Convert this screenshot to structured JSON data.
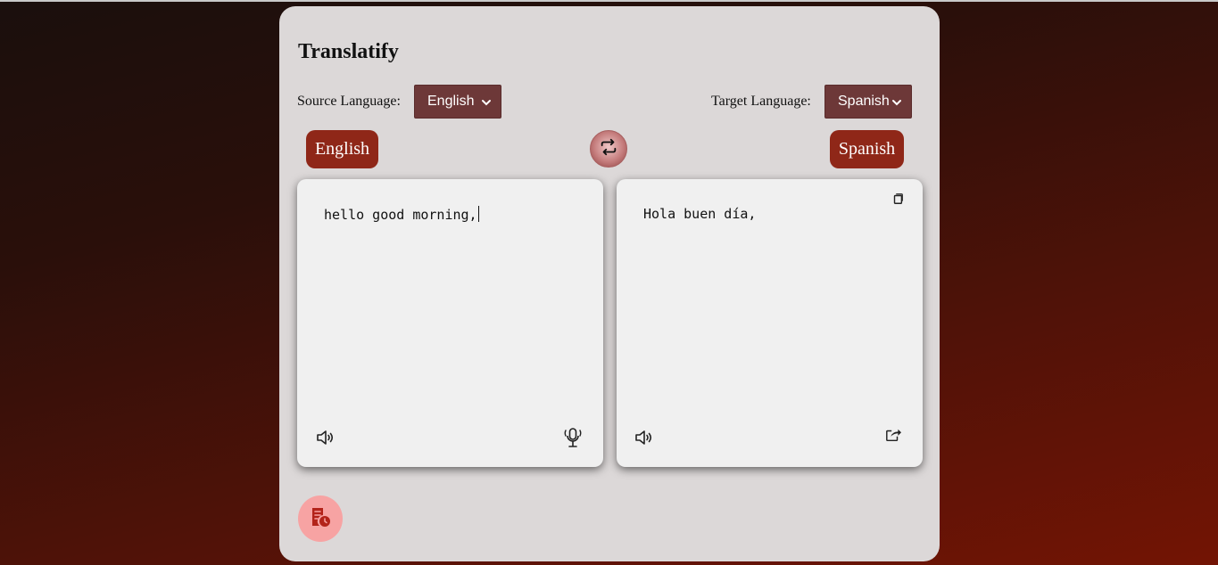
{
  "app": {
    "title": "Translatify"
  },
  "source": {
    "label": "Source Language:",
    "selected": "English",
    "badge": "English",
    "text": "hello good morning,"
  },
  "target": {
    "label": "Target Language:",
    "selected": "Spanish",
    "badge": "Spanish",
    "text": "Hola buen día,"
  },
  "icons": {
    "swap": "swap-arrows-icon",
    "source_speak": "speaker-icon",
    "source_mic": "microphone-icon",
    "target_copy": "copy-icon",
    "target_speak": "speaker-icon",
    "target_share": "share-icon",
    "history": "history-icon"
  },
  "colors": {
    "page_bg_top": "#1a0f0d",
    "page_bg_bottom": "#731404",
    "card_bg": "#dcd8d8",
    "select_bg": "#6d3838",
    "badge_bg": "#8f2718",
    "history_bg": "#f7a3a3"
  }
}
